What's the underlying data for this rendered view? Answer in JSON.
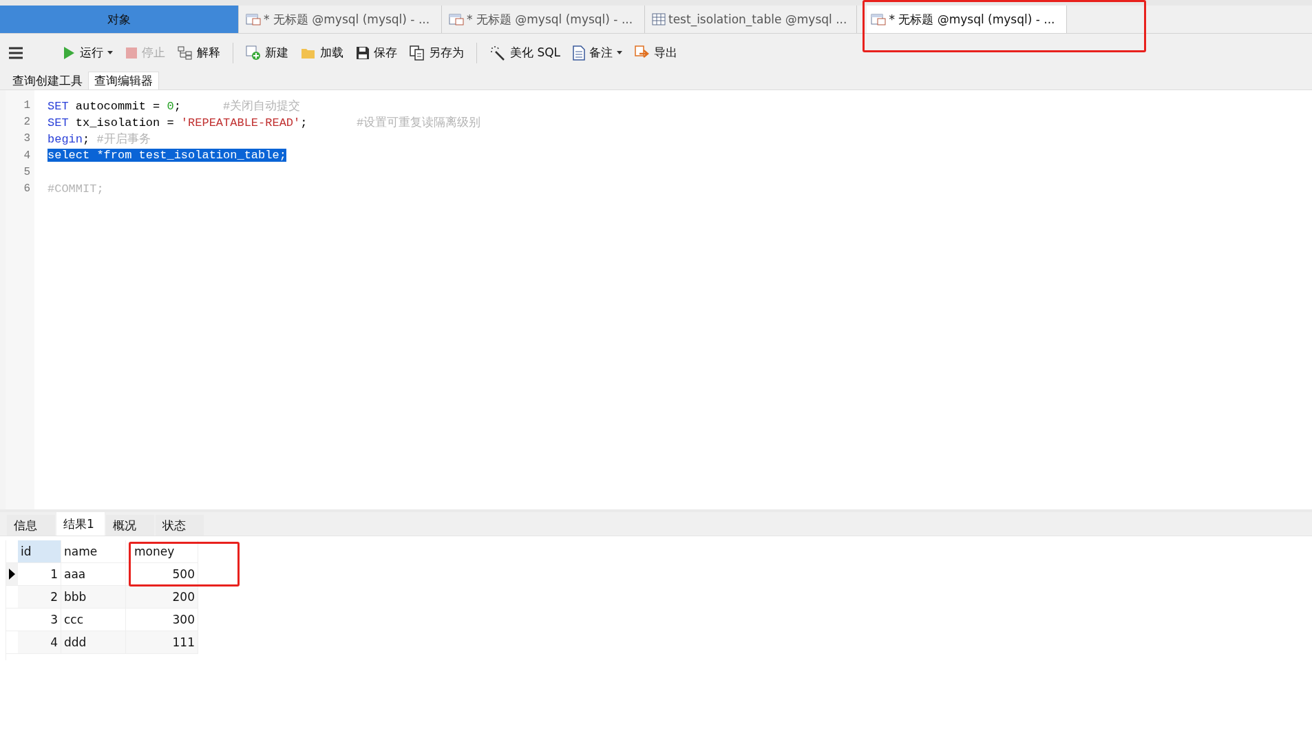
{
  "tabs": [
    {
      "kind": "objects",
      "label": "对象",
      "selected": false,
      "highlighted": false
    },
    {
      "kind": "query",
      "label": "* 无标题 @mysql (mysql) - ...",
      "selected": false,
      "highlighted": false
    },
    {
      "kind": "query",
      "label": "* 无标题 @mysql (mysql) - ...",
      "selected": false,
      "highlighted": false
    },
    {
      "kind": "table",
      "label": "test_isolation_table @mysql ...",
      "selected": false,
      "highlighted": false
    },
    {
      "kind": "query",
      "label": "* 无标题 @mysql (mysql) - ...",
      "selected": true,
      "highlighted": true
    }
  ],
  "toolbar": [
    {
      "kind": "run",
      "label": "运行",
      "dropdown": true,
      "disabled": false
    },
    {
      "kind": "stop",
      "label": "停止",
      "dropdown": false,
      "disabled": true
    },
    {
      "kind": "explain",
      "label": "解释",
      "dropdown": false,
      "disabled": false
    },
    {
      "kind": "new",
      "label": "新建",
      "dropdown": false,
      "disabled": false
    },
    {
      "kind": "load",
      "label": "加载",
      "dropdown": false,
      "disabled": false
    },
    {
      "kind": "save",
      "label": "保存",
      "dropdown": false,
      "disabled": false
    },
    {
      "kind": "saveas",
      "label": "另存为",
      "dropdown": false,
      "disabled": false
    },
    {
      "kind": "beautify",
      "label": "美化 SQL",
      "dropdown": false,
      "disabled": false
    },
    {
      "kind": "note",
      "label": "备注",
      "dropdown": true,
      "disabled": false
    },
    {
      "kind": "export",
      "label": "导出",
      "dropdown": false,
      "disabled": false
    }
  ],
  "editor_tabs": [
    {
      "label": "查询创建工具",
      "selected": false
    },
    {
      "label": "查询编辑器",
      "selected": true
    }
  ],
  "code_lines": [
    {
      "number": "1",
      "selected": false,
      "tokens": [
        {
          "kind": "keyword",
          "text": "SET"
        },
        {
          "kind": "plain",
          "text": " autocommit = "
        },
        {
          "kind": "number",
          "text": "0"
        },
        {
          "kind": "plain",
          "text": ";      "
        },
        {
          "kind": "comment",
          "text": "#关闭自动提交"
        }
      ]
    },
    {
      "number": "2",
      "selected": false,
      "tokens": [
        {
          "kind": "keyword",
          "text": "SET"
        },
        {
          "kind": "plain",
          "text": " tx_isolation = "
        },
        {
          "kind": "string",
          "text": "'REPEATABLE-READ'"
        },
        {
          "kind": "plain",
          "text": ";       "
        },
        {
          "kind": "comment",
          "text": "#设置可重复读隔离级别"
        }
      ]
    },
    {
      "number": "3",
      "selected": false,
      "tokens": [
        {
          "kind": "keyword",
          "text": "begin"
        },
        {
          "kind": "plain",
          "text": "; "
        },
        {
          "kind": "comment",
          "text": "#开启事务"
        }
      ]
    },
    {
      "number": "4",
      "selected": true,
      "tokens": [
        {
          "kind": "plain",
          "text": "select *from test_isolation_table;"
        }
      ]
    },
    {
      "number": "5",
      "selected": false
    },
    {
      "number": "6",
      "selected": false,
      "tokens": [
        {
          "kind": "comment",
          "text": "#COMMIT;"
        }
      ]
    }
  ],
  "result_tabs": [
    {
      "label": "信息",
      "selected": false
    },
    {
      "label": "结果1",
      "selected": true
    },
    {
      "label": "概况",
      "selected": false
    },
    {
      "label": "状态",
      "selected": false
    }
  ],
  "result_table": {
    "columns": [
      {
        "label": "id",
        "selected": true,
        "highlighted": false
      },
      {
        "label": "name",
        "selected": false,
        "highlighted": false
      },
      {
        "label": "money",
        "selected": false,
        "highlighted": true
      }
    ],
    "rows": [
      {
        "current": true,
        "cells": [
          "1",
          "aaa",
          "500"
        ]
      },
      {
        "current": false,
        "cells": [
          "2",
          "bbb",
          "200"
        ]
      },
      {
        "current": false,
        "cells": [
          "3",
          "ccc",
          "300"
        ]
      },
      {
        "current": false,
        "cells": [
          "4",
          "ddd",
          "111"
        ]
      }
    ]
  }
}
